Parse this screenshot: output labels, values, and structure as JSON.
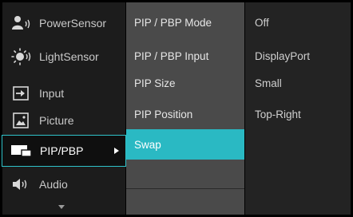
{
  "main_menu": {
    "items": [
      {
        "label": "PowerSensor",
        "icon": "power-sensor-icon"
      },
      {
        "label": "LightSensor",
        "icon": "light-sensor-icon"
      },
      {
        "label": "Input",
        "icon": "input-icon"
      },
      {
        "label": "Picture",
        "icon": "picture-icon"
      },
      {
        "label": "PIP/PBP",
        "icon": "pip-pbp-icon",
        "selected": true
      },
      {
        "label": "Audio",
        "icon": "audio-icon"
      }
    ]
  },
  "submenu": {
    "items": [
      {
        "label": "PIP / PBP Mode"
      },
      {
        "label": "PIP / PBP Input"
      },
      {
        "label": "PIP Size"
      },
      {
        "label": "PIP Position"
      },
      {
        "label": "Swap",
        "highlighted": true
      }
    ]
  },
  "values": {
    "items": [
      {
        "label": "Off"
      },
      {
        "label": "DisplayPort"
      },
      {
        "label": "Small"
      },
      {
        "label": "Top-Right"
      }
    ]
  },
  "colors": {
    "accent": "#2ab9c3",
    "selected_border": "#2fc2c9",
    "main_bg": "#1c1c1c",
    "sub_bg": "#4a4a4a",
    "value_bg": "#232323"
  }
}
